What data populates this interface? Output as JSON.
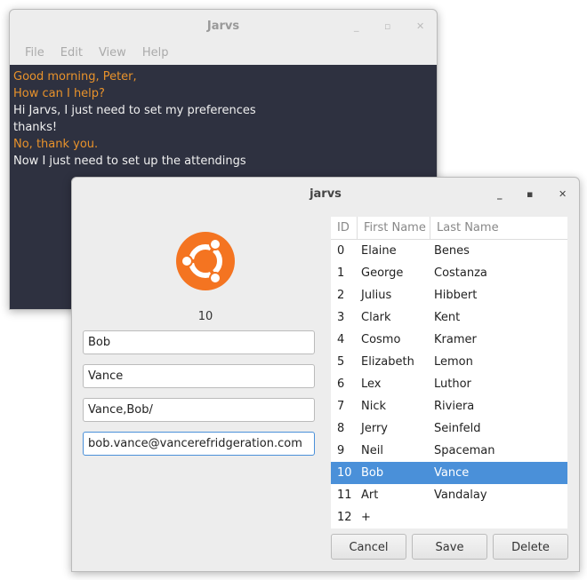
{
  "back_window": {
    "title": "Jarvs",
    "menu": [
      "File",
      "Edit",
      "View",
      "Help"
    ],
    "lines": [
      {
        "text": "Good morning, Peter,",
        "color": "#e8922b"
      },
      {
        "text": "How can I help?",
        "color": "#e8922b"
      },
      {
        "text": "Hi Jarvs, I just need to set my preferences",
        "color": "#f0f0f0"
      },
      {
        "text": "thanks!",
        "color": "#f0f0f0"
      },
      {
        "text": "No, thank you.",
        "color": "#e8922b"
      },
      {
        "text": "Now I just need to set up the attendings",
        "color": "#f0f0f0"
      }
    ]
  },
  "front_window": {
    "title": "jarvs",
    "logo": "ubuntu-logo",
    "logo_color": "#f47421",
    "id_label": "10",
    "fields": {
      "first_name": "Bob",
      "last_name": "Vance",
      "name_path": "Vance,Bob/",
      "email": "bob.vance@vancerefridgeration.com"
    },
    "table": {
      "headers": [
        "ID",
        "First Name",
        "Last Name"
      ],
      "rows": [
        [
          "0",
          "Elaine",
          "Benes"
        ],
        [
          "1",
          "George",
          "Costanza"
        ],
        [
          "2",
          "Julius",
          "Hibbert"
        ],
        [
          "3",
          "Clark",
          "Kent"
        ],
        [
          "4",
          "Cosmo",
          "Kramer"
        ],
        [
          "5",
          "Elizabeth",
          "Lemon"
        ],
        [
          "6",
          "Lex",
          "Luthor"
        ],
        [
          "7",
          "Nick",
          "Riviera"
        ],
        [
          "8",
          "Jerry",
          "Seinfeld"
        ],
        [
          "9",
          "Neil",
          "Spaceman"
        ],
        [
          "10",
          "Bob",
          "Vance"
        ],
        [
          "11",
          "Art",
          "Vandalay"
        ],
        [
          "12",
          "+",
          ""
        ]
      ],
      "selected_index": 10,
      "selection_color": "#4a90d9"
    },
    "buttons": {
      "cancel": "Cancel",
      "save": "Save",
      "delete": "Delete"
    }
  }
}
